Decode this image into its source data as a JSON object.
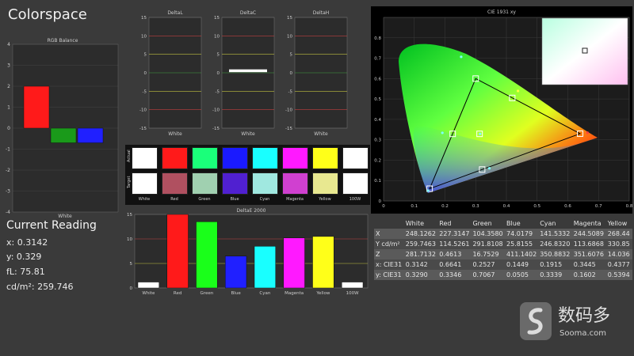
{
  "app": {
    "title": "Colorspace",
    "watermark_text": "数码多",
    "watermark_url": "Sooma.com"
  },
  "reading": {
    "title": "Current Reading",
    "x": "x: 0.3142",
    "y": "y: 0.329",
    "fl": "fL: 75.81",
    "cd": "cd/m²: 259.746"
  },
  "swatches": {
    "row_actual_label": "Actual",
    "row_target_label": "Target",
    "names": [
      "White",
      "Red",
      "Green",
      "Blue",
      "Cyan",
      "Magenta",
      "Yellow",
      "100W"
    ],
    "actual_colors": [
      "#ffffff",
      "#ff1a1a",
      "#1aff7a",
      "#1a1aff",
      "#19ffff",
      "#ff19ff",
      "#ffff19",
      "#ffffff"
    ],
    "target_colors": [
      "#ffffff",
      "#b05060",
      "#a0d0b0",
      "#5020d0",
      "#a0e8e0",
      "#d040d0",
      "#e8e890",
      "#ffffff"
    ]
  },
  "table": {
    "headers": [
      "",
      "White",
      "Red",
      "Green",
      "Blue",
      "Cyan",
      "Magenta",
      "Yellow"
    ],
    "rows": [
      [
        "X",
        "248.1262",
        "227.3147",
        "104.3580",
        "74.0179",
        "141.5332",
        "244.5089",
        "268.44"
      ],
      [
        "Y cd/m²",
        "259.7463",
        "114.5261",
        "291.8108",
        "25.8155",
        "246.8320",
        "113.6868",
        "330.85"
      ],
      [
        "Z",
        "281.7132",
        "0.4613",
        "16.7529",
        "411.1402",
        "350.8832",
        "351.6076",
        "14.036"
      ],
      [
        "x: CIE31",
        "0.3142",
        "0.6641",
        "0.2527",
        "0.1449",
        "0.1915",
        "0.3445",
        "0.4377"
      ],
      [
        "y: CIE31",
        "0.3290",
        "0.3346",
        "0.7067",
        "0.0505",
        "0.3339",
        "0.1602",
        "0.5394"
      ]
    ]
  },
  "chart_data": [
    {
      "type": "bar",
      "title": "RGB Balance",
      "categories": [
        "White"
      ],
      "series": [
        {
          "name": "",
          "color": "#ff1a1a",
          "values": [
            2
          ]
        },
        {
          "name": "",
          "color": "#1a9a1a",
          "values": [
            -0.7
          ]
        },
        {
          "name": "",
          "color": "#2020ff",
          "values": [
            -0.7
          ]
        }
      ],
      "ylim": [
        -4,
        4
      ],
      "yticks": [
        "4",
        "3",
        "2",
        "1",
        "0",
        "-1",
        "-2",
        "-3",
        "-4"
      ]
    },
    {
      "type": "bar",
      "title": "DeltaL",
      "categories": [
        "White"
      ],
      "values": [
        0
      ],
      "ylim": [
        -15,
        15
      ],
      "yticks": [
        "15",
        "10",
        "5",
        "0",
        "-5",
        "-10",
        "-15"
      ]
    },
    {
      "type": "bar",
      "title": "DeltaC",
      "categories": [
        "White"
      ],
      "values": [
        0.6
      ],
      "ylim": [
        -15,
        15
      ],
      "yticks": [
        "15",
        "10",
        "5",
        "0",
        "-5",
        "-10",
        "-15"
      ]
    },
    {
      "type": "bar",
      "title": "DeltaH",
      "categories": [
        "White"
      ],
      "values": [
        0
      ],
      "ylim": [
        -15,
        15
      ],
      "yticks": [
        "15",
        "10",
        "5",
        "0",
        "-5",
        "-10",
        "-15"
      ]
    },
    {
      "type": "bar",
      "title": "DeltaE 2000",
      "categories": [
        "White",
        "Red",
        "Green",
        "Blue",
        "Cyan",
        "Magenta",
        "Yellow",
        "100W"
      ],
      "colors": [
        "#ffffff",
        "#ff1a1a",
        "#1aff1a",
        "#2020ff",
        "#19ffff",
        "#ff19ff",
        "#ffff19",
        "#ffffff"
      ],
      "values": [
        1.2,
        15,
        13.5,
        6.5,
        8.5,
        10.2,
        10.5,
        1.2
      ],
      "ylim": [
        0,
        15
      ],
      "yticks": [
        "15",
        "10",
        "5",
        "0"
      ]
    },
    {
      "type": "scatter",
      "title": "CIE 1931 xy",
      "xlim": [
        0,
        0.8
      ],
      "ylim": [
        0,
        0.9
      ],
      "xticks": [
        "0",
        "0.1",
        "0.2",
        "0.3",
        "0.4",
        "0.5",
        "0.6",
        "0.7",
        "0.8"
      ],
      "yticks": [
        "0.8",
        "0.7",
        "0.6",
        "0.5",
        "0.4",
        "0.3",
        "0.2",
        "0.1",
        "0"
      ],
      "target_points": [
        [
          0.64,
          0.33
        ],
        [
          0.3,
          0.6
        ],
        [
          0.15,
          0.06
        ],
        [
          0.225,
          0.329
        ],
        [
          0.321,
          0.154
        ],
        [
          0.419,
          0.505
        ],
        [
          0.3127,
          0.329
        ]
      ],
      "measured_points": [
        [
          0.6641,
          0.3346
        ],
        [
          0.2527,
          0.7067
        ],
        [
          0.1449,
          0.0505
        ],
        [
          0.1915,
          0.3339
        ],
        [
          0.3445,
          0.1602
        ],
        [
          0.4377,
          0.5394
        ],
        [
          0.3142,
          0.329
        ]
      ]
    }
  ]
}
